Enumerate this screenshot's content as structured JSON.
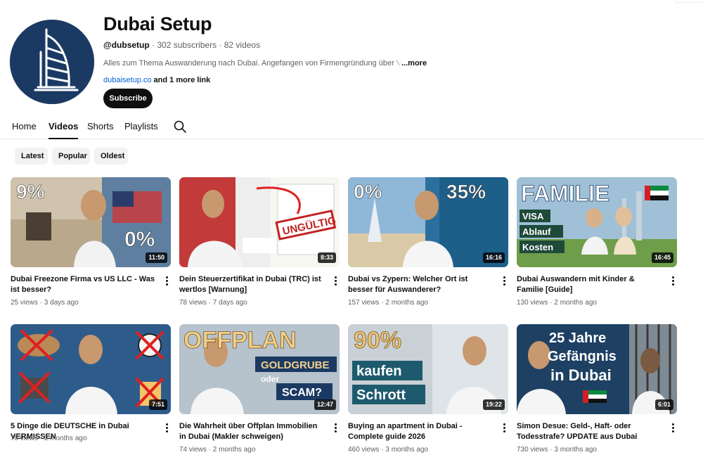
{
  "channel": {
    "name": "Dubai Setup",
    "handle": "@dubsetup",
    "stats": " · 302 subscribers · 82 videos",
    "description": "Alles zum Thema Auswanderung nach Dubai. Angefangen von Firmengründung über VIS",
    "more_label": "...more",
    "link": "dubaisetup.co",
    "more_links": " and 1 more link",
    "subscribe_label": "Subscribe",
    "avatar_icon": "burj-al-arab-logo",
    "brand_color": "#1b3a63"
  },
  "tabs": [
    {
      "label": "Home",
      "active": false
    },
    {
      "label": "Videos",
      "active": true
    },
    {
      "label": "Shorts",
      "active": false
    },
    {
      "label": "Playlists",
      "active": false
    }
  ],
  "tab_search_icon": "search-icon",
  "chips": [
    "Latest",
    "Popular",
    "Oldest"
  ],
  "videos": [
    {
      "title": "Dubai Freezone Firma vs US LLC - Was ist besser?",
      "views": "25 views",
      "age": "3 days ago",
      "duration": "11:50",
      "thumb_text": [
        "9%",
        "0%"
      ]
    },
    {
      "title": "Dein Steuerzertifikat in Dubai (TRC) ist wertlos [Warnung]",
      "views": "78 views",
      "age": "7 days ago",
      "duration": "8:33",
      "thumb_text": [
        "UNGÜLTIG"
      ]
    },
    {
      "title": "Dubai vs Zypern: Welcher Ort ist besser für Auswanderer?",
      "views": "157 views",
      "age": "2 months ago",
      "duration": "16:16",
      "thumb_text": [
        "0%",
        "35%"
      ]
    },
    {
      "title": "Dubai Auswandern mit Kinder & Familie [Guide]",
      "views": "130 views",
      "age": "2 months ago",
      "duration": "16:45",
      "thumb_text": [
        "FAMILIE",
        "VISA",
        "Ablauf",
        "Kosten"
      ]
    },
    {
      "title": "5 Dinge die DEUTSCHE in Dubai VERMISSEN",
      "views": "78 views",
      "age": "2 months ago",
      "duration": "7:51",
      "thumb_text": []
    },
    {
      "title": "Die Wahrheit über Offplan Immobilien in Dubai (Makler schweigen)",
      "views": "74 views",
      "age": "2 months ago",
      "duration": "12:47",
      "thumb_text": [
        "OFFPLAN",
        "GOLDGRUBE",
        "oder",
        "SCAM?"
      ]
    },
    {
      "title": "Buying an apartment in Dubai - Complete guide 2026",
      "views": "460 views",
      "age": "3 months ago",
      "duration": "19:22",
      "thumb_text": [
        "90%",
        "kaufen",
        "Schrott"
      ]
    },
    {
      "title": "Simon Desue: Geld-, Haft- oder Todesstrafe? UPDATE aus Dubai",
      "views": "730 views",
      "age": "3 months ago",
      "duration": "6:01",
      "thumb_text": [
        "25 Jahre",
        "Gefängnis",
        "in Dubai"
      ]
    }
  ]
}
